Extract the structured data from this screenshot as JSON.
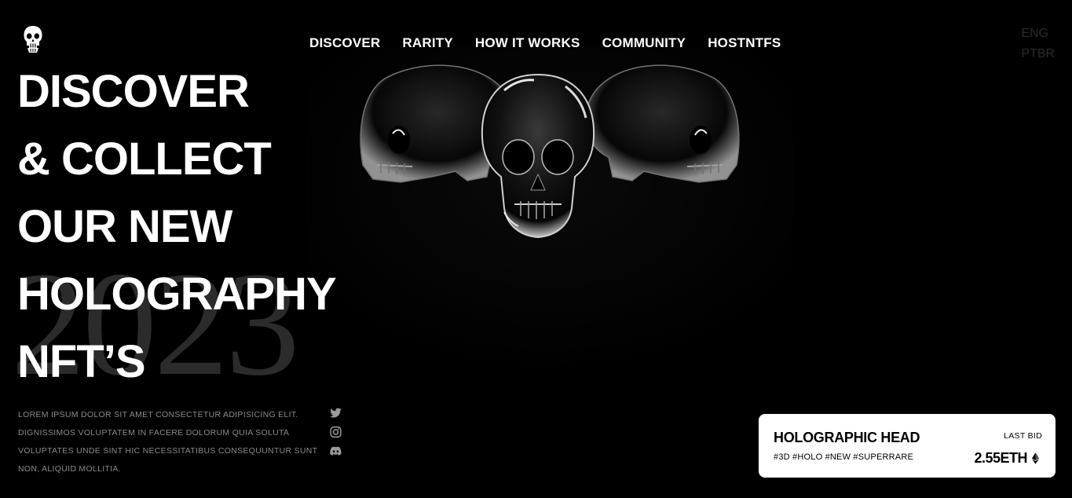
{
  "nav": {
    "items": [
      {
        "label": "DISCOVER"
      },
      {
        "label": "RARITY"
      },
      {
        "label": "HOW IT WORKS"
      },
      {
        "label": "COMMUNITY"
      },
      {
        "label": "HOSTNTFS"
      }
    ]
  },
  "language": {
    "options": [
      "ENG",
      "PTBR"
    ]
  },
  "logo": {
    "icon": "skull-icon"
  },
  "hero": {
    "headline_lines": [
      "DISCOVER",
      "& COLLECT",
      "OUR NEW",
      "HOLOGRAPHY",
      "NFT’S"
    ],
    "background_year": "2023",
    "art": "three-chrome-skulls"
  },
  "description": {
    "lines": [
      "LOREM IPSUM DOLOR SIT AMET CONSECTETUR ADIPISICING ELIT.",
      "DIGNISSIMOS VOLUPTATEM IN FACERE DOLORUM QUIA SOLUTA",
      "VOLUPTATES UNDE SINT HIC NECESSITATIBUS CONSEQUUNTUR SUNT",
      "NON, ALIQUID MOLLITIA."
    ]
  },
  "social": {
    "icons": [
      "twitter-icon",
      "instagram-icon",
      "discord-icon"
    ]
  },
  "card": {
    "title": "HOLOGRAPHIC HEAD",
    "tags": "#3D #HOLO #NEW #SUPERRARE",
    "bid_label": "LAST BID",
    "price": "2.55ETH",
    "currency_icon": "ethereum-icon"
  },
  "colors": {
    "background": "#000000",
    "text": "#ffffff",
    "muted": "#8a8a8a",
    "year": "#2b2b2b",
    "lang": "#2a2a2a",
    "card_bg": "#ffffff"
  }
}
